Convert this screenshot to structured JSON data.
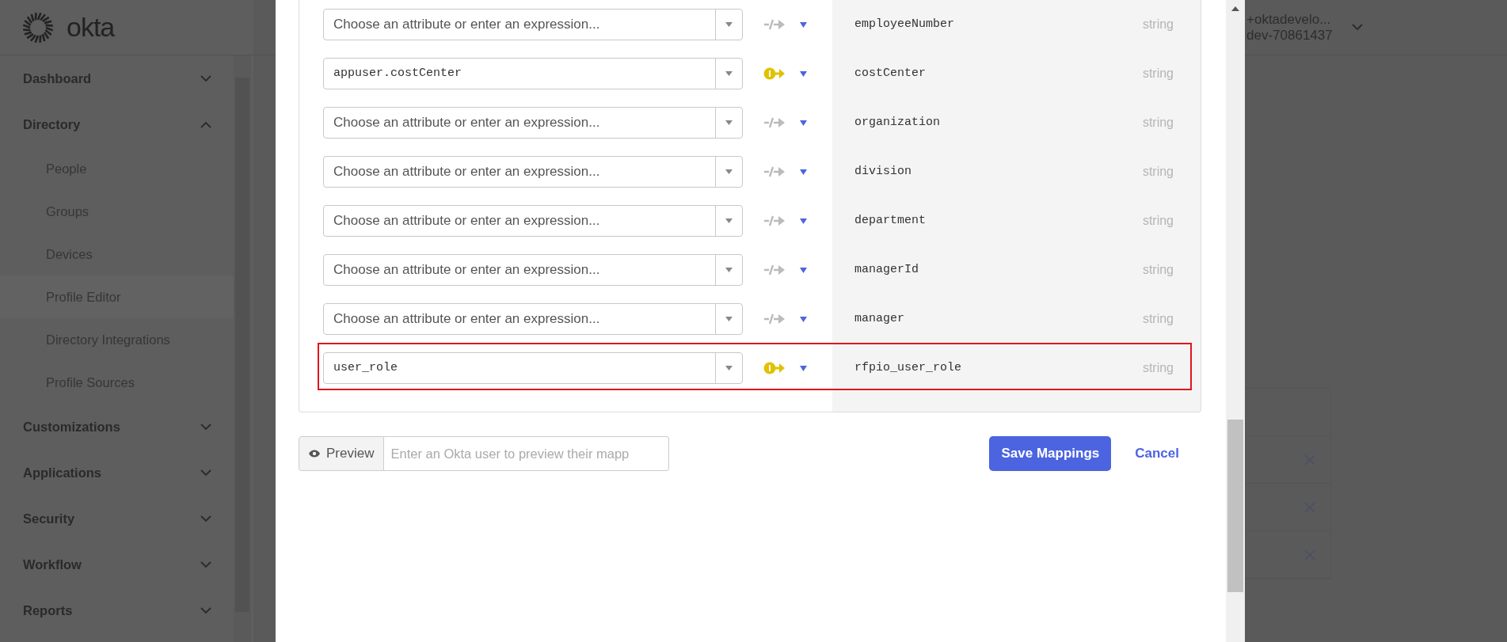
{
  "sidebar": {
    "logo": "okta",
    "items": [
      {
        "label": "Dashboard",
        "expanded": false
      },
      {
        "label": "Directory",
        "expanded": true,
        "children": [
          {
            "label": "People",
            "selected": false
          },
          {
            "label": "Groups",
            "selected": false
          },
          {
            "label": "Devices",
            "selected": false
          },
          {
            "label": "Profile Editor",
            "selected": true
          },
          {
            "label": "Directory Integrations",
            "selected": false
          },
          {
            "label": "Profile Sources",
            "selected": false
          }
        ]
      },
      {
        "label": "Customizations",
        "expanded": false
      },
      {
        "label": "Applications",
        "expanded": false
      },
      {
        "label": "Security",
        "expanded": false
      },
      {
        "label": "Workflow",
        "expanded": false
      },
      {
        "label": "Reports",
        "expanded": false
      }
    ]
  },
  "header": {
    "user": "+oktadevelo...",
    "org": "dev-70861437"
  },
  "mappings": {
    "rows": [
      {
        "placeholder": "Choose an attribute or enter an expression...",
        "mapped": false,
        "attribute": "employeeNumber",
        "type": "string",
        "highlighted": false
      },
      {
        "value": "appuser.costCenter",
        "mapped": true,
        "attribute": "costCenter",
        "type": "string",
        "highlighted": false
      },
      {
        "placeholder": "Choose an attribute or enter an expression...",
        "mapped": false,
        "attribute": "organization",
        "type": "string",
        "highlighted": false
      },
      {
        "placeholder": "Choose an attribute or enter an expression...",
        "mapped": false,
        "attribute": "division",
        "type": "string",
        "highlighted": false
      },
      {
        "placeholder": "Choose an attribute or enter an expression...",
        "mapped": false,
        "attribute": "department",
        "type": "string",
        "highlighted": false
      },
      {
        "placeholder": "Choose an attribute or enter an expression...",
        "mapped": false,
        "attribute": "managerId",
        "type": "string",
        "highlighted": false
      },
      {
        "placeholder": "Choose an attribute or enter an expression...",
        "mapped": false,
        "attribute": "manager",
        "type": "string",
        "highlighted": false
      },
      {
        "value": "user_role",
        "mapped": true,
        "attribute": "rfpio_user_role",
        "type": "string",
        "highlighted": true
      }
    ]
  },
  "preview": {
    "button": "Preview",
    "placeholder": "Enter an Okta user to preview their mapp"
  },
  "actions": {
    "save": "Save Mappings",
    "cancel": "Cancel"
  }
}
